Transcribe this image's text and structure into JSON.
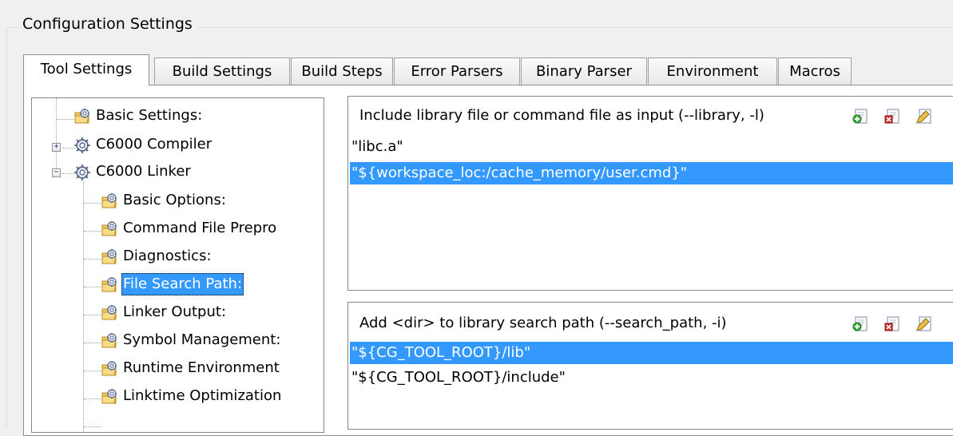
{
  "group": {
    "title": "Configuration Settings"
  },
  "tabs": [
    {
      "label": "Tool Settings",
      "active": true
    },
    {
      "label": "Build Settings",
      "active": false
    },
    {
      "label": "Build Steps",
      "active": false
    },
    {
      "label": "Error Parsers",
      "active": false
    },
    {
      "label": "Binary Parser",
      "active": false
    },
    {
      "label": "Environment",
      "active": false
    },
    {
      "label": "Macros",
      "active": false
    }
  ],
  "tree": {
    "items": [
      {
        "label": "Basic Settings:",
        "icon": "folder-settings-icon"
      },
      {
        "label": "C6000 Compiler",
        "icon": "tool-settings-icon",
        "expander": "+"
      },
      {
        "label": "C6000 Linker",
        "icon": "tool-settings-icon",
        "expander": "−"
      },
      {
        "label": "Basic Options:",
        "icon": "folder-settings-icon"
      },
      {
        "label": "Command File Prepro",
        "icon": "folder-settings-icon"
      },
      {
        "label": "Diagnostics:",
        "icon": "folder-settings-icon"
      },
      {
        "label": "File Search Path:",
        "icon": "folder-settings-icon",
        "selected": true
      },
      {
        "label": "Linker Output:",
        "icon": "folder-settings-icon"
      },
      {
        "label": "Symbol Management:",
        "icon": "folder-settings-icon"
      },
      {
        "label": "Runtime Environment",
        "icon": "folder-settings-icon"
      },
      {
        "label": "Linktime Optimization",
        "icon": "folder-settings-icon"
      }
    ]
  },
  "library_panel": {
    "header": "Include library file or command file as input (--library, -l)",
    "rows": [
      {
        "text": "\"libc.a\"",
        "selected": false
      },
      {
        "text": "\"${workspace_loc:/cache_memory/user.cmd}\"",
        "selected": true
      }
    ],
    "buttons": [
      "add-icon",
      "delete-icon",
      "edit-icon"
    ]
  },
  "search_panel": {
    "header": "Add <dir> to library search path (--search_path, -i)",
    "rows": [
      {
        "text": "\"${CG_TOOL_ROOT}/lib\"",
        "selected": true
      },
      {
        "text": "\"${CG_TOOL_ROOT}/include\"",
        "selected": false
      }
    ],
    "buttons": [
      "add-icon",
      "delete-icon",
      "edit-icon"
    ]
  },
  "colors": {
    "selection": "#3399ff",
    "window_bg": "#f0f0f0",
    "border": "#828790"
  }
}
